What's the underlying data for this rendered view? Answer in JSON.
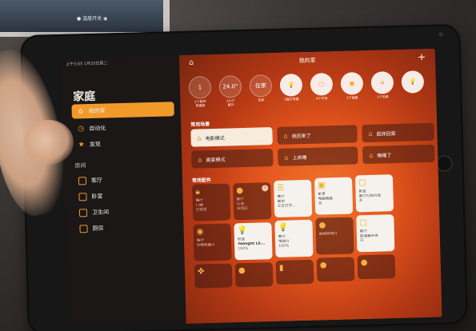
{
  "background_device": {
    "text": "● 温度开关 ◉"
  },
  "status_bar": {
    "time": "上午3:05  1月25日周二"
  },
  "sidebar": {
    "title": "家庭",
    "items": [
      {
        "label": "我的家",
        "icon": "house-icon",
        "active": true
      },
      {
        "label": "自动化",
        "icon": "automation-icon",
        "active": false
      },
      {
        "label": "发现",
        "icon": "star-icon",
        "active": false
      }
    ],
    "rooms_label": "房间",
    "rooms": [
      {
        "label": "客厅"
      },
      {
        "label": "卧室"
      },
      {
        "label": "卫生间"
      },
      {
        "label": "厨房"
      }
    ]
  },
  "main": {
    "title": "我的家",
    "status": [
      {
        "value": "1",
        "caption": "1个配件\n将更新"
      },
      {
        "value": "24.0°",
        "caption": "24.0°\n室外"
      },
      {
        "value": "在家",
        "caption": "在家"
      },
      {
        "value": "",
        "caption": "3盏灯亮着"
      },
      {
        "value": "",
        "caption": "4个开关"
      },
      {
        "value": "",
        "caption": "1个插座"
      },
      {
        "value": "",
        "caption": "1个风扇"
      },
      {
        "value": "",
        "caption": ""
      }
    ],
    "scenes_label": "常用场景",
    "scenes": [
      {
        "label": "电影模式",
        "light": true
      },
      {
        "label": "我回来了",
        "light": false
      },
      {
        "label": "起床回家",
        "light": false
      },
      {
        "label": "离家模式",
        "light": false
      },
      {
        "label": "上床睡",
        "light": false
      },
      {
        "label": "晚睡了",
        "light": false
      }
    ],
    "accessories_label": "常用配件",
    "accessories": [
      {
        "room": "客厅",
        "name": "门锁",
        "state": "已锁定",
        "light": false,
        "icon": "lock-icon"
      },
      {
        "room": "客厅",
        "name": "灯泡",
        "state": "未响应",
        "light": false,
        "icon": "bulb-icon",
        "tag": "!"
      },
      {
        "room": "客厅",
        "name": "窗帘",
        "state": "正在打开...",
        "light": true,
        "icon": "blind-icon"
      },
      {
        "room": "卧室",
        "name": "电脑插座",
        "state": "关",
        "light": true,
        "icon": "plug-icon"
      },
      {
        "room": "卧室",
        "name": "客厅灯控开关",
        "state": "开",
        "light": true,
        "icon": "switch-icon"
      },
      {
        "room": "客厅",
        "name": "扫地机器人",
        "state": "",
        "light": false,
        "icon": "robot-icon"
      },
      {
        "room": "卧室",
        "name": "Yeelight LE...",
        "state": "100%",
        "light": true,
        "icon": "bulb-icon"
      },
      {
        "room": "客厅",
        "name": "电视灯",
        "state": "100%",
        "light": true,
        "icon": "bulb-icon"
      },
      {
        "room": "",
        "name": "厨房照明灯",
        "state": "",
        "light": false,
        "icon": "bulb-icon"
      },
      {
        "room": "客厅",
        "name": "加湿器开关",
        "state": "开",
        "light": true,
        "icon": "switch-icon"
      }
    ]
  },
  "colors": {
    "accent": "#f19a2a",
    "background_orange": "#e2541c"
  }
}
